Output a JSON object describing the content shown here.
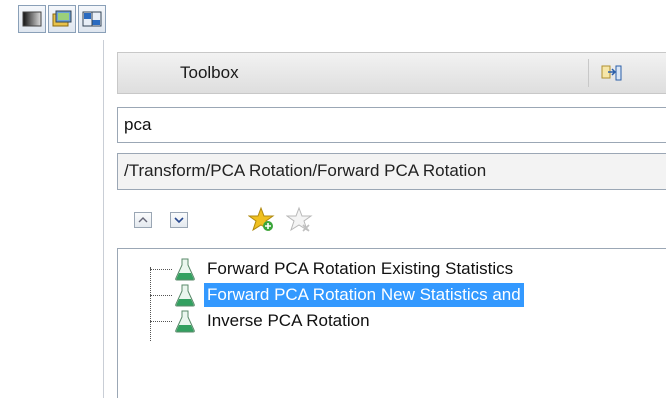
{
  "toolbar": {
    "buttons": [
      {
        "icon": "gradient-window-icon"
      },
      {
        "icon": "folder-image-icon"
      },
      {
        "icon": "split-view-icon"
      }
    ]
  },
  "toolbox": {
    "title": "Toolbox",
    "undock_icon": "undock-icon"
  },
  "search": {
    "value": "pca"
  },
  "path": {
    "text": "/Transform/PCA Rotation/Forward PCA Rotation"
  },
  "mini_toolbar": {
    "collapse_icon": "chevron-up-icon",
    "expand_icon": "chevron-down-icon",
    "add_favorite_icon": "star-add-icon",
    "remove_favorite_icon": "star-remove-icon"
  },
  "tree": {
    "items": [
      {
        "label": "Forward PCA Rotation Existing Statistics",
        "selected": false
      },
      {
        "label": "Forward PCA Rotation New Statistics and",
        "selected": true
      },
      {
        "label": "Inverse PCA Rotation",
        "selected": false
      }
    ]
  },
  "colors": {
    "selection": "#3399ff",
    "accent_star": "#f0c020"
  }
}
